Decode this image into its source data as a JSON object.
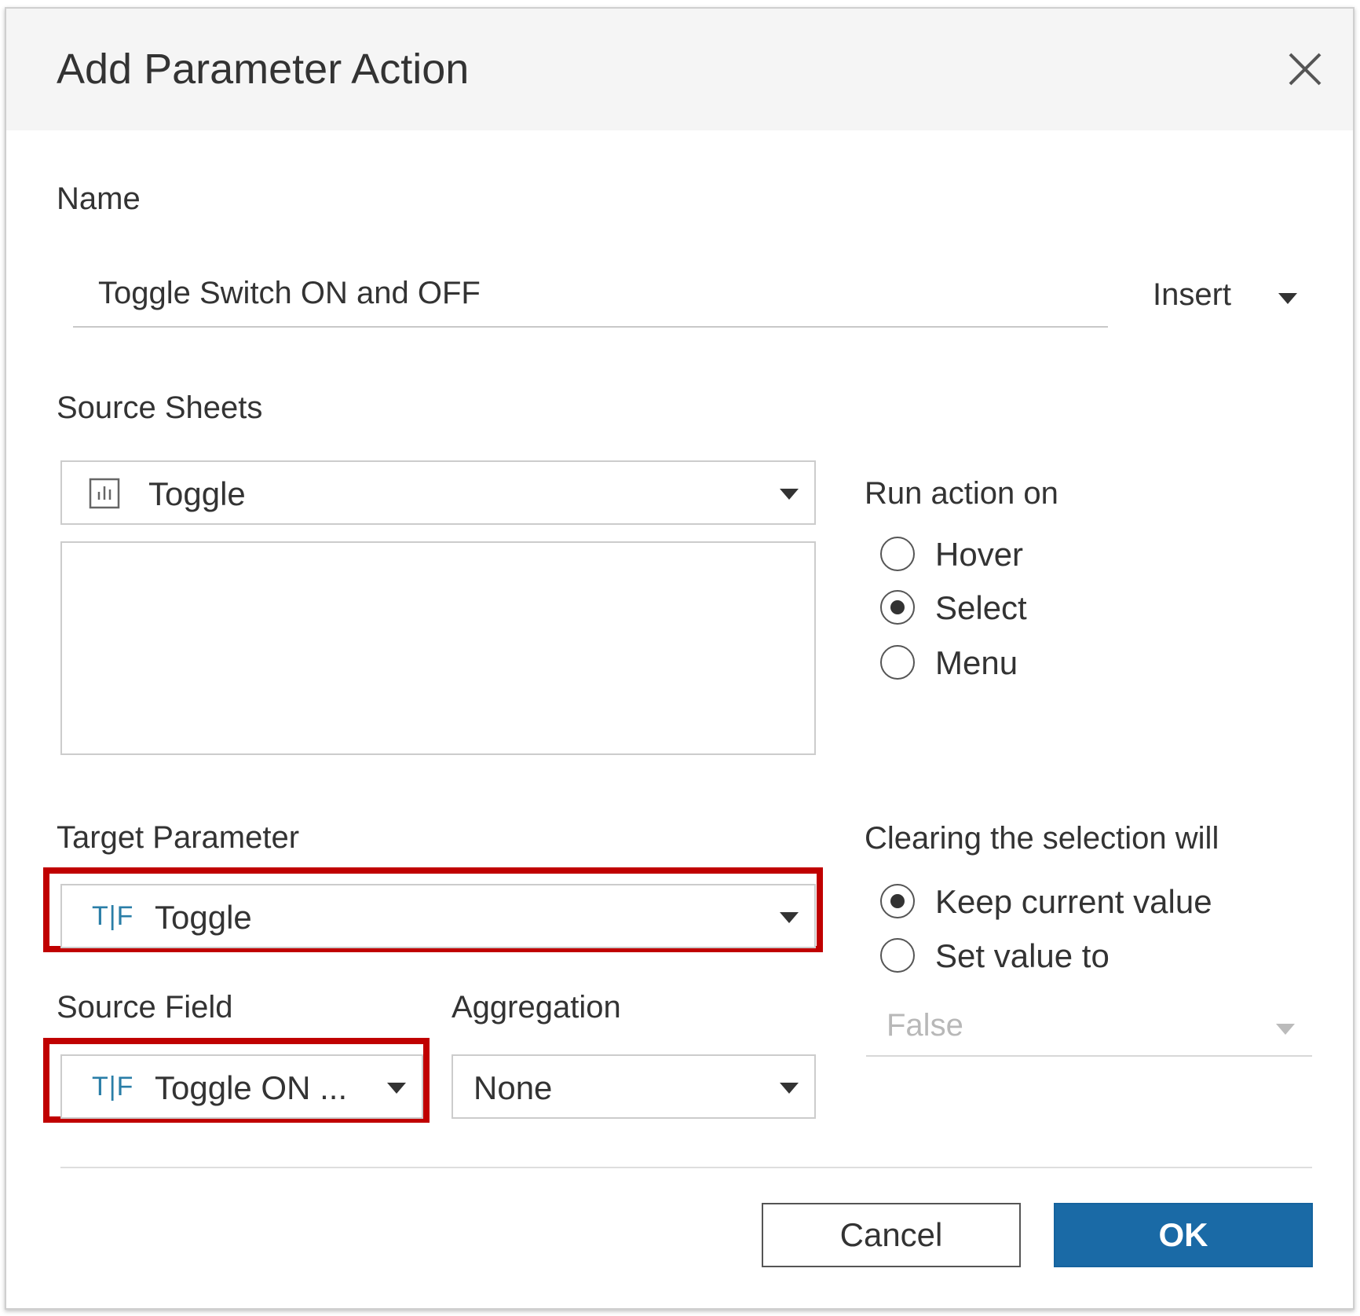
{
  "dialog": {
    "title": "Add Parameter Action",
    "close_icon": "close-icon"
  },
  "name": {
    "label": "Name",
    "value": "Toggle Switch ON and OFF",
    "insert_label": "Insert"
  },
  "source_sheets": {
    "label": "Source Sheets",
    "selected": "Toggle",
    "icon": "sheet-icon"
  },
  "run_action_on": {
    "label": "Run action on",
    "options": [
      {
        "label": "Hover",
        "selected": false
      },
      {
        "label": "Select",
        "selected": true
      },
      {
        "label": "Menu",
        "selected": false
      }
    ]
  },
  "target_parameter": {
    "label": "Target Parameter",
    "icon_text": "T|F",
    "value": "Toggle"
  },
  "source_field": {
    "label": "Source Field",
    "icon_text": "T|F",
    "value": "Toggle ON ..."
  },
  "aggregation": {
    "label": "Aggregation",
    "value": "None"
  },
  "clearing": {
    "label": "Clearing the selection will",
    "options": [
      {
        "label": "Keep current value",
        "selected": true
      },
      {
        "label": "Set value to",
        "selected": false
      }
    ],
    "set_value": "False"
  },
  "buttons": {
    "cancel": "Cancel",
    "ok": "OK"
  },
  "colors": {
    "highlight": "#c00000",
    "ok_button": "#1a6aa6",
    "tf_icon": "#2a7ea7"
  }
}
